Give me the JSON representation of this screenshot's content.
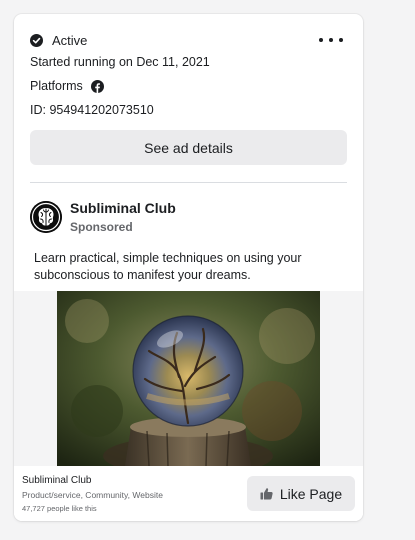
{
  "status": {
    "label": "Active",
    "icon": "check-circle-icon"
  },
  "more_menu": {
    "icon": "more-options-icon"
  },
  "started_running": "Started running on Dec 11, 2021",
  "platforms": {
    "label": "Platforms",
    "icons": [
      "facebook-icon"
    ]
  },
  "ad_id": "ID: 954941202073510",
  "details_button": {
    "label": "See ad details"
  },
  "ad": {
    "page_name": "Subliminal Club",
    "sponsored": "Sponsored",
    "body": "Learn practical, simple techniques on using your subconscious to manifest your dreams.",
    "image": "crystal-ball-photo"
  },
  "footer": {
    "page_name": "Subliminal Club",
    "category": "Product/service, Community, Website",
    "likes": "47,727 people like this",
    "like_button": {
      "label": "Like Page",
      "icon": "thumbs-up-icon"
    }
  },
  "colors": {
    "text_primary": "#1c1e21",
    "text_secondary": "#65676b",
    "button_bg": "#ebebed",
    "divider": "#dadde1"
  }
}
